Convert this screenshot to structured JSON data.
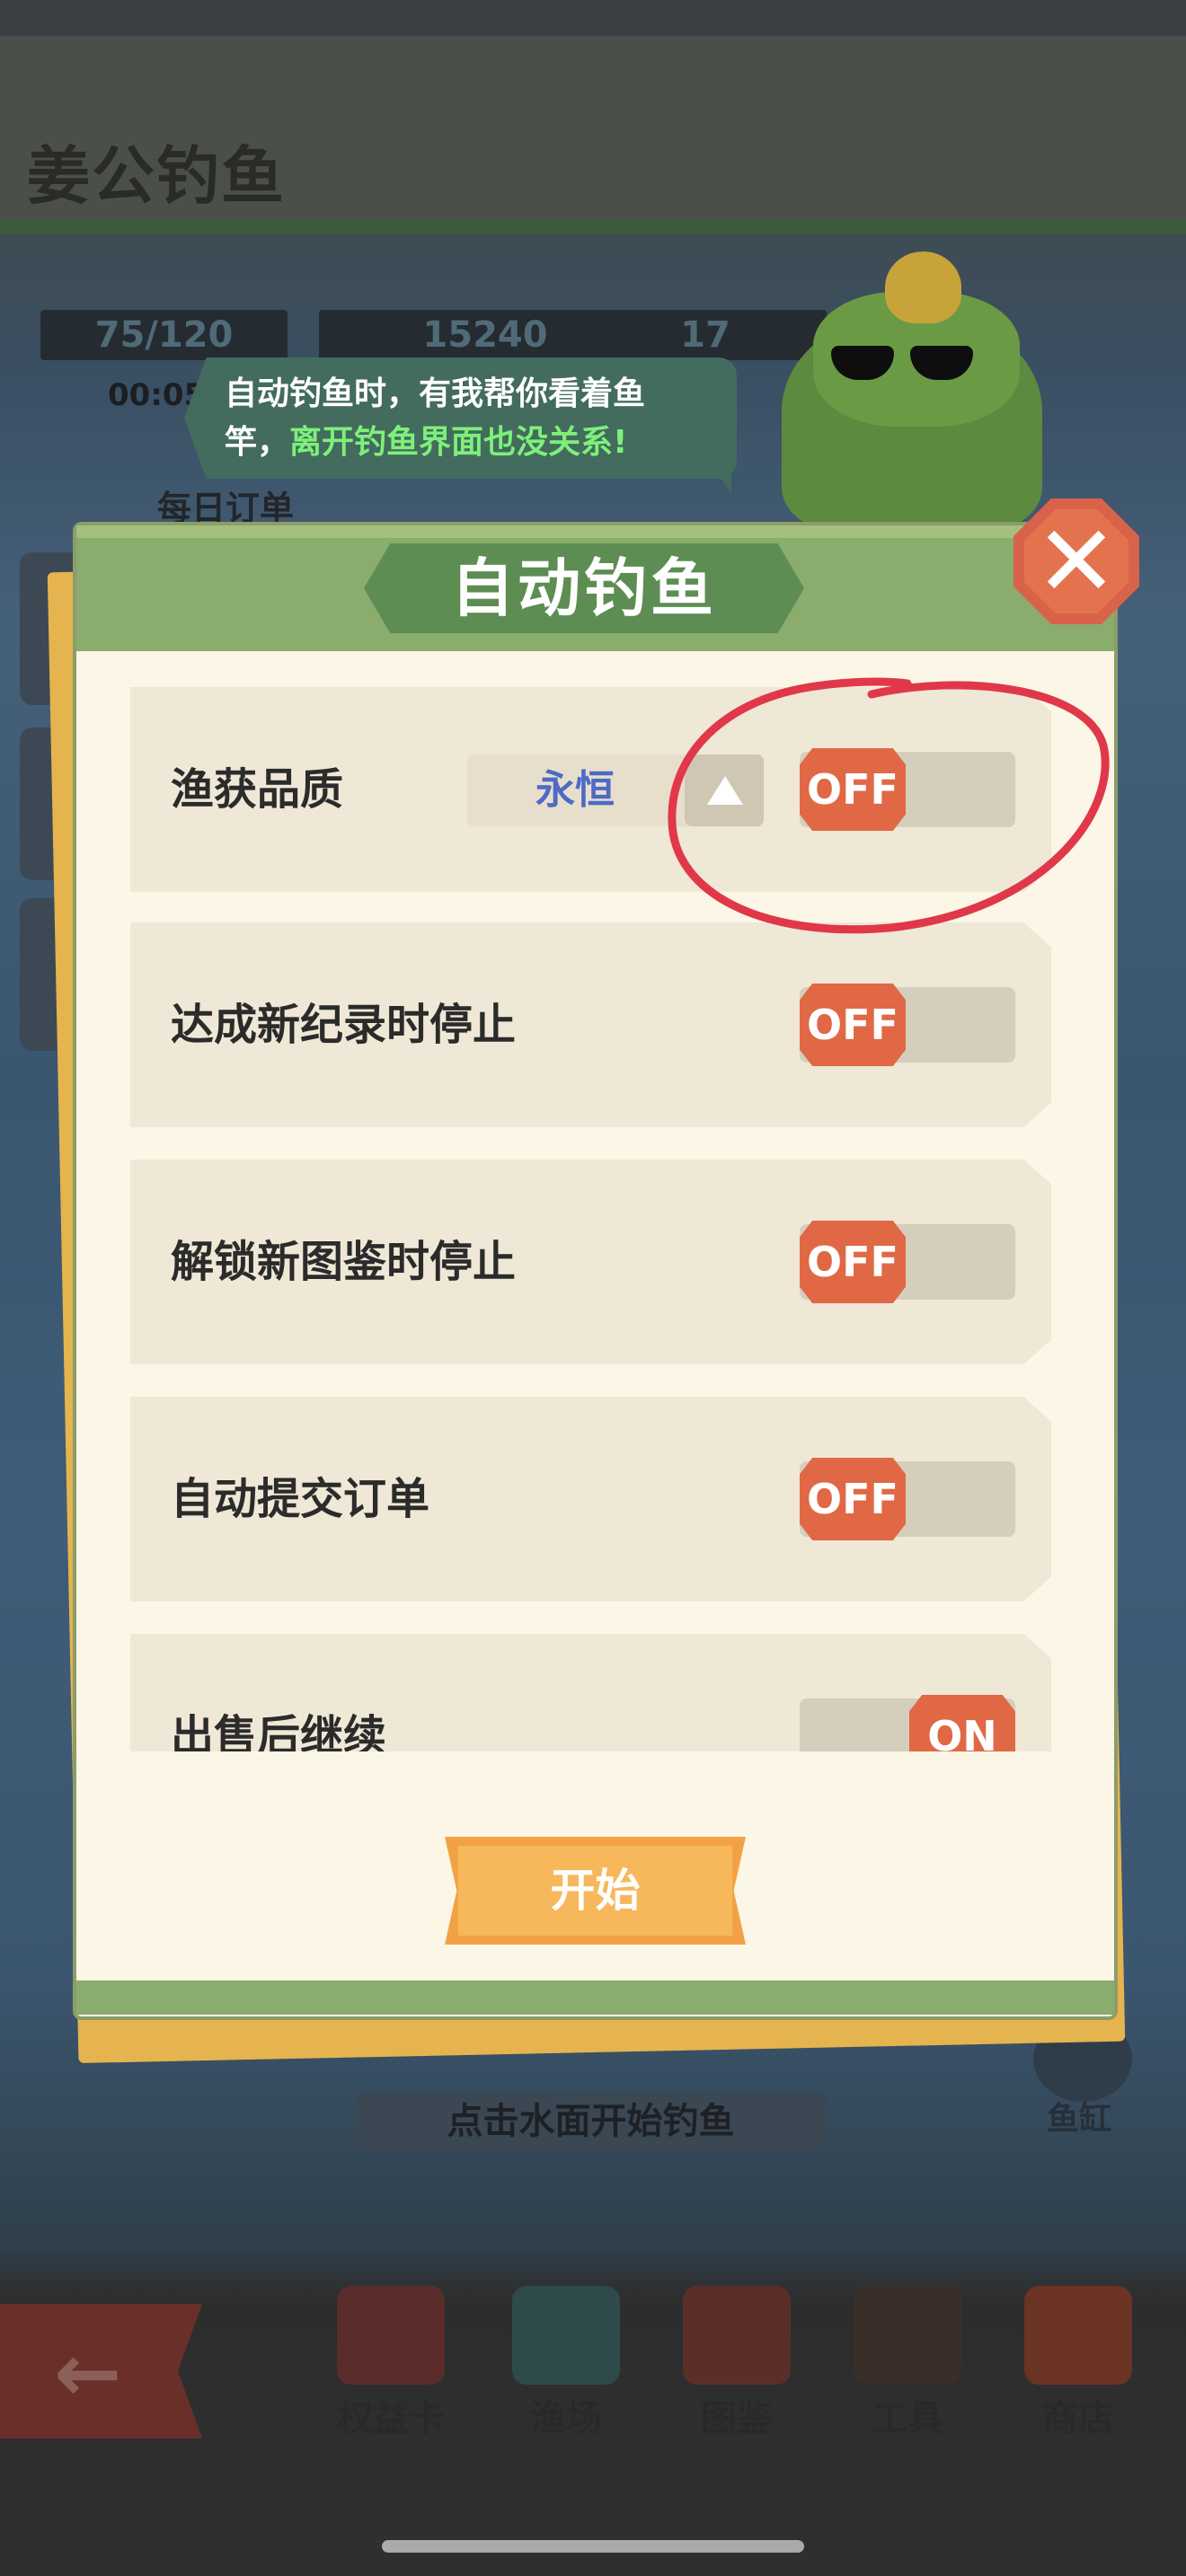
{
  "game": {
    "title": "姜公钓鱼",
    "stats": {
      "energy": "75/120",
      "coins": "15240",
      "hammers": "17"
    },
    "timer": "00:05",
    "daily_orders": "每日订单",
    "hint": "点击水面开始钓鱼",
    "fish_tank": "鱼缸"
  },
  "bubble": {
    "line1": "自动钓鱼时，有我帮你看着鱼",
    "line2_prefix": "竿，",
    "line2_highlight": "离开钓鱼界面也没关系!"
  },
  "modal": {
    "title": "自动钓鱼",
    "close_icon": "close-icon",
    "rows": [
      {
        "label": "渔获品质",
        "selector_value": "永恒",
        "toggle": "OFF"
      },
      {
        "label": "达成新纪录时停止",
        "toggle": "OFF"
      },
      {
        "label": "解锁新图鉴时停止",
        "toggle": "OFF"
      },
      {
        "label": "自动提交订单",
        "toggle": "OFF"
      },
      {
        "label": "出售后继续",
        "toggle": "ON"
      }
    ],
    "start_label": "开始"
  },
  "bottom_nav": [
    {
      "label": "权益卡",
      "icon": "card-icon"
    },
    {
      "label": "渔场",
      "icon": "island-icon"
    },
    {
      "label": "图鉴",
      "icon": "fish-scroll-icon"
    },
    {
      "label": "工具",
      "icon": "basket-icon"
    },
    {
      "label": "商店",
      "icon": "bag-icon"
    }
  ],
  "colors": {
    "toggle_knob": "#e06845",
    "header_green": "#8aac6c",
    "start_orange": "#f2a244",
    "highlight_green": "#7ef07a",
    "annotation_red": "#e0384a"
  }
}
